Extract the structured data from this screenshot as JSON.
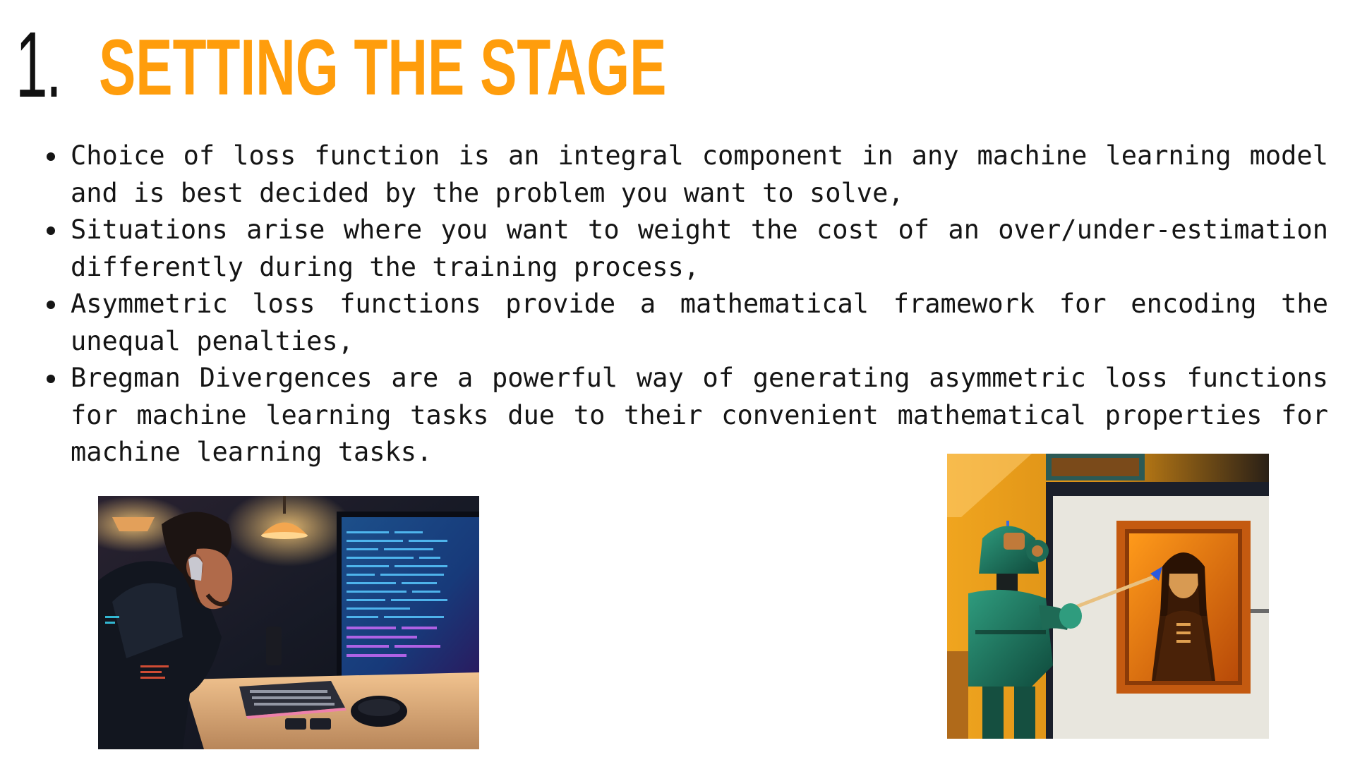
{
  "header": {
    "number": "1.",
    "title": "SETTING THE STAGE"
  },
  "bullets": [
    "Choice of loss function is an integral component in any machine learning model and is best decided by the problem you want to solve,",
    "Situations arise where you want to weight the cost of an over/under-estimation differently during the training process,",
    "Asymmetric loss functions provide a mathematical framework for encoding the unequal penalties,",
    "Bregman Divergences are a powerful way of generating asymmetric loss functions for machine learning tasks due to their convenient mathematical properties for machine learning tasks."
  ],
  "colors": {
    "title": "#ff9d0c",
    "number": "#111111",
    "text": "#151515"
  }
}
